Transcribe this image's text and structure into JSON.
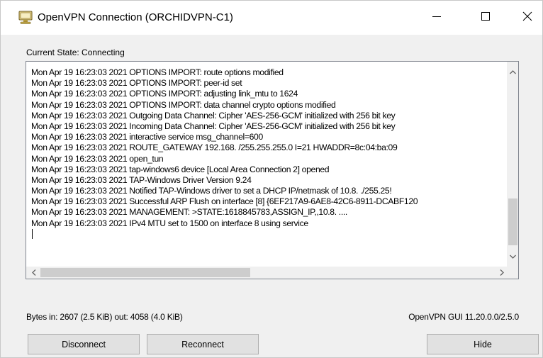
{
  "window": {
    "title": "OpenVPN Connection (ORCHIDVPN-C1)",
    "app_icon": "openvpn-monitor-icon",
    "controls": {
      "minimize_icon": "minimize-icon",
      "maximize_icon": "maximize-icon",
      "close_icon": "close-icon"
    }
  },
  "status": {
    "current_state": "Current State: Connecting"
  },
  "log": {
    "lines": [
      "Mon Apr 19 16:23:03 2021 OPTIONS IMPORT: route options modified",
      "Mon Apr 19 16:23:03 2021 OPTIONS IMPORT: peer-id set",
      "Mon Apr 19 16:23:03 2021 OPTIONS IMPORT: adjusting link_mtu to 1624",
      "Mon Apr 19 16:23:03 2021 OPTIONS IMPORT: data channel crypto options modified",
      "Mon Apr 19 16:23:03 2021 Outgoing Data Channel: Cipher 'AES-256-GCM' initialized with 256 bit key",
      "Mon Apr 19 16:23:03 2021 Incoming Data Channel: Cipher 'AES-256-GCM' initialized with 256 bit key",
      "Mon Apr 19 16:23:03 2021 interactive service msg_channel=600",
      "Mon Apr 19 16:23:03 2021 ROUTE_GATEWAY 192.168.      /255.255.255.0 I=21 HWADDR=8c:04:ba:09",
      "Mon Apr 19 16:23:03 2021 open_tun",
      "Mon Apr 19 16:23:03 2021 tap-windows6 device [Local Area Connection 2] opened",
      "Mon Apr 19 16:23:03 2021 TAP-Windows Driver Version 9.24",
      "Mon Apr 19 16:23:03 2021 Notified TAP-Windows driver to set a DHCP IP/netmask of 10.8.       ./255.25!",
      "Mon Apr 19 16:23:03 2021 Successful ARP Flush on interface [8] {6EF217A9-6AE8-42C6-8911-DCABF120",
      "Mon Apr 19 16:23:03 2021 MANAGEMENT: >STATE:1618845783,ASSIGN_IP,,10.8.          ....",
      "Mon Apr 19 16:23:03 2021 IPv4 MTU set to 1500 on interface 8 using service"
    ],
    "scroll": {
      "up_icon": "scroll-up-arrow-icon",
      "down_icon": "scroll-down-arrow-icon",
      "left_icon": "scroll-left-arrow-icon",
      "right_icon": "scroll-right-arrow-icon"
    }
  },
  "footer": {
    "bytes": "Bytes in: 2607 (2.5 KiB)  out: 4058 (4.0 KiB)",
    "version": "OpenVPN GUI 11.20.0.0/2.5.0"
  },
  "buttons": {
    "disconnect": "Disconnect",
    "reconnect": "Reconnect",
    "hide": "Hide"
  }
}
